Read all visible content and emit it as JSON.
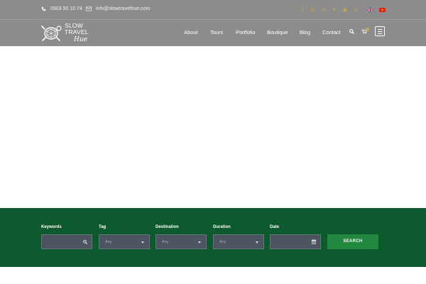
{
  "topbar": {
    "phone": "0903 50 10 74",
    "email": "info@slowtravelhue.com",
    "social_icons": [
      "facebook-icon",
      "linkedin-icon",
      "pinterest-icon",
      "twitter-icon",
      "youtube-icon",
      "instagram-icon"
    ],
    "languages": [
      "English",
      "Vietnamese"
    ]
  },
  "logo": {
    "line1": "SLOW",
    "line2": "TRAVEL",
    "script": "Hue"
  },
  "nav": {
    "items": [
      "About",
      "Tours",
      "Portfolio",
      "Boutique",
      "Blog",
      "Contact"
    ]
  },
  "search_form": {
    "keywords_label": "Keywords",
    "tag_label": "Tag",
    "tag_value": "Any",
    "destination_label": "Destination",
    "destination_value": "Any",
    "duration_label": "Duration",
    "duration_value": "Any",
    "date_label": "Date",
    "button_label": "SEARCH"
  },
  "colors": {
    "header_bg": "#8c8c8c",
    "accent_gold": "#c9a84e",
    "band_green": "#0e5a2f",
    "button_green": "#22873f"
  }
}
